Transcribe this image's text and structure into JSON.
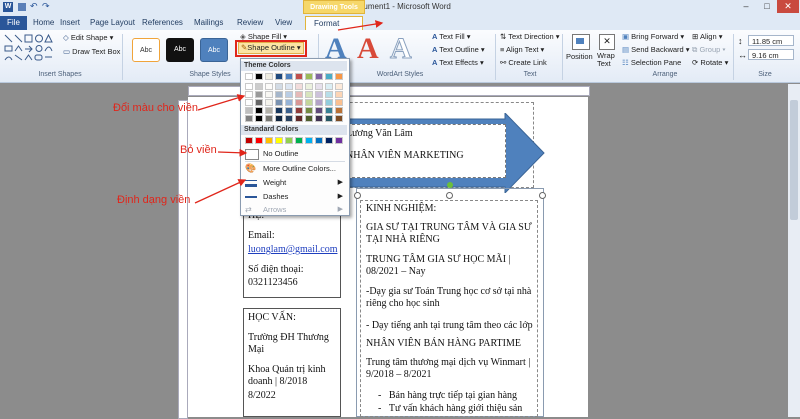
{
  "window": {
    "title": "Document1 - Microsoft Word",
    "tool_tab": "Drawing Tools",
    "controls": [
      "–",
      "□",
      "✕"
    ]
  },
  "tabs": [
    "File",
    "Home",
    "Insert",
    "Page Layout",
    "References",
    "Mailings",
    "Review",
    "View",
    "Format"
  ],
  "ribbon": {
    "edit_shape": "Edit Shape",
    "draw_text_box": "Draw Text Box",
    "insert_shapes_label": "Insert Shapes",
    "style_abc": "Abc",
    "shape_fill": "Shape Fill",
    "shape_outline": "Shape Outline",
    "shape_styles_label": "Shape Styles",
    "wordart_styles_label": "WordArt Styles",
    "text_fill": "Text Fill",
    "text_outline": "Text Outline",
    "text_effects": "Text Effects",
    "text_direction": "Text Direction",
    "align_text": "Align Text",
    "create_link": "Create Link",
    "text_label": "Text",
    "position": "Position",
    "wrap_text": "Wrap Text",
    "bring_forward": "Bring Forward",
    "send_backward": "Send Backward",
    "selection_pane": "Selection Pane",
    "align": "Align",
    "group": "Group",
    "rotate": "Rotate",
    "arrange_label": "Arrange",
    "height": "11.85 cm",
    "width": "9.16 cm",
    "size_label": "Size"
  },
  "dropdown": {
    "theme_colors": "Theme Colors",
    "standard_colors": "Standard Colors",
    "no_outline": "No Outline",
    "more_colors": "More Outline Colors...",
    "weight": "Weight",
    "dashes": "Dashes",
    "arrows": "Arrows",
    "theme_top": [
      "#ffffff",
      "#000000",
      "#eeece1",
      "#1f497d",
      "#4f81bd",
      "#c0504d",
      "#9bbb59",
      "#8064a2",
      "#4bacc6",
      "#f79646"
    ],
    "standard": [
      "#c00000",
      "#ff0000",
      "#ffc000",
      "#ffff00",
      "#92d050",
      "#00b050",
      "#00b0f0",
      "#0070c0",
      "#002060",
      "#7030a0"
    ]
  },
  "annotations": {
    "color": "Đổi màu cho viền",
    "remove": "Bỏ viền",
    "format": "Định dạng viền"
  },
  "document": {
    "name": "Lương Văn Lâm",
    "position": "NHÂN VIÊN MARKETING",
    "contact_heading": "HỆ:",
    "email_label": "Email:",
    "email": "luonglam@gmail.com",
    "phone_label": "Số điện thoại:",
    "phone": "0321123456",
    "edu_heading": "HỌC VẤN:",
    "school": "Trường ĐH Thương Mại",
    "faculty": "Khoa Quản trị kinh doanh | 8/2018",
    "edu_end": "8/2022",
    "exp_heading": "KINH NGHIỆM:",
    "exp1_title": "GIA SƯ TẠI TRUNG TÂM VÀ GIA SƯ TẠI NHÀ RIÊNG",
    "exp1_place": "TRUNG TÂM GIA SƯ HỌC MÃI | 08/2021 – Nay",
    "exp1_task1": "-Dạy gia sư Toán Trung học cơ sở tại nhà riêng cho học sinh",
    "exp1_task2": "- Dạy tiếng anh tại trung tâm theo các lớp",
    "exp2_title": "NHÂN VIÊN BÁN HÀNG PARTIME",
    "exp2_place": "Trung tâm thương mại dịch vụ Winmart | 9/2018 – 8/2021",
    "exp2_task1": "Bán hàng trực tiếp tại gian hàng",
    "exp2_task2": "Tư vấn khách hàng giới thiệu sản"
  }
}
